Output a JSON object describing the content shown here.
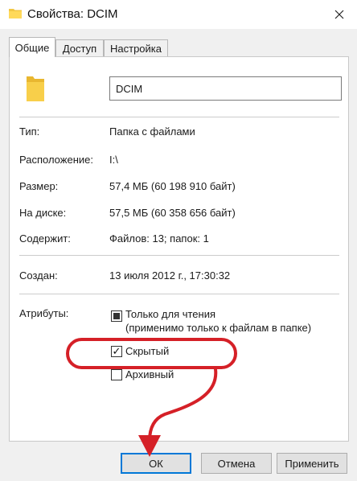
{
  "window": {
    "title": "Свойства: DCIM",
    "close_glyph": "✕"
  },
  "tabs": [
    {
      "label": "Общие",
      "active": true
    },
    {
      "label": "Доступ",
      "active": false
    },
    {
      "label": "Настройка",
      "active": false
    }
  ],
  "general": {
    "name_value": "DCIM",
    "type": {
      "label": "Тип:",
      "value": "Папка с файлами"
    },
    "location": {
      "label": "Расположение:",
      "value": "I:\\"
    },
    "size": {
      "label": "Размер:",
      "value": "57,4 МБ (60 198 910 байт)"
    },
    "on_disk": {
      "label": "На диске:",
      "value": "57,5 МБ (60 358 656 байт)"
    },
    "contains": {
      "label": "Содержит:",
      "value": "Файлов: 13; папок: 1"
    },
    "created": {
      "label": "Создан:",
      "value": "13 июля 2012 г., 17:30:32"
    },
    "attributes": {
      "label": "Атрибуты:",
      "readonly": {
        "label_line1": "Только для чтения",
        "label_line2": "(применимо только к файлам в папке)",
        "state": "indeterminate"
      },
      "hidden": {
        "label": "Скрытый",
        "checked": true,
        "check_glyph": "✓"
      },
      "archive": {
        "label": "Архивный",
        "checked": false
      }
    }
  },
  "buttons": {
    "ok": "ОК",
    "cancel": "Отмена",
    "apply": "Применить"
  },
  "colors": {
    "annotation": "#d52027",
    "folder": "#f2c744",
    "accent": "#0078d7"
  }
}
